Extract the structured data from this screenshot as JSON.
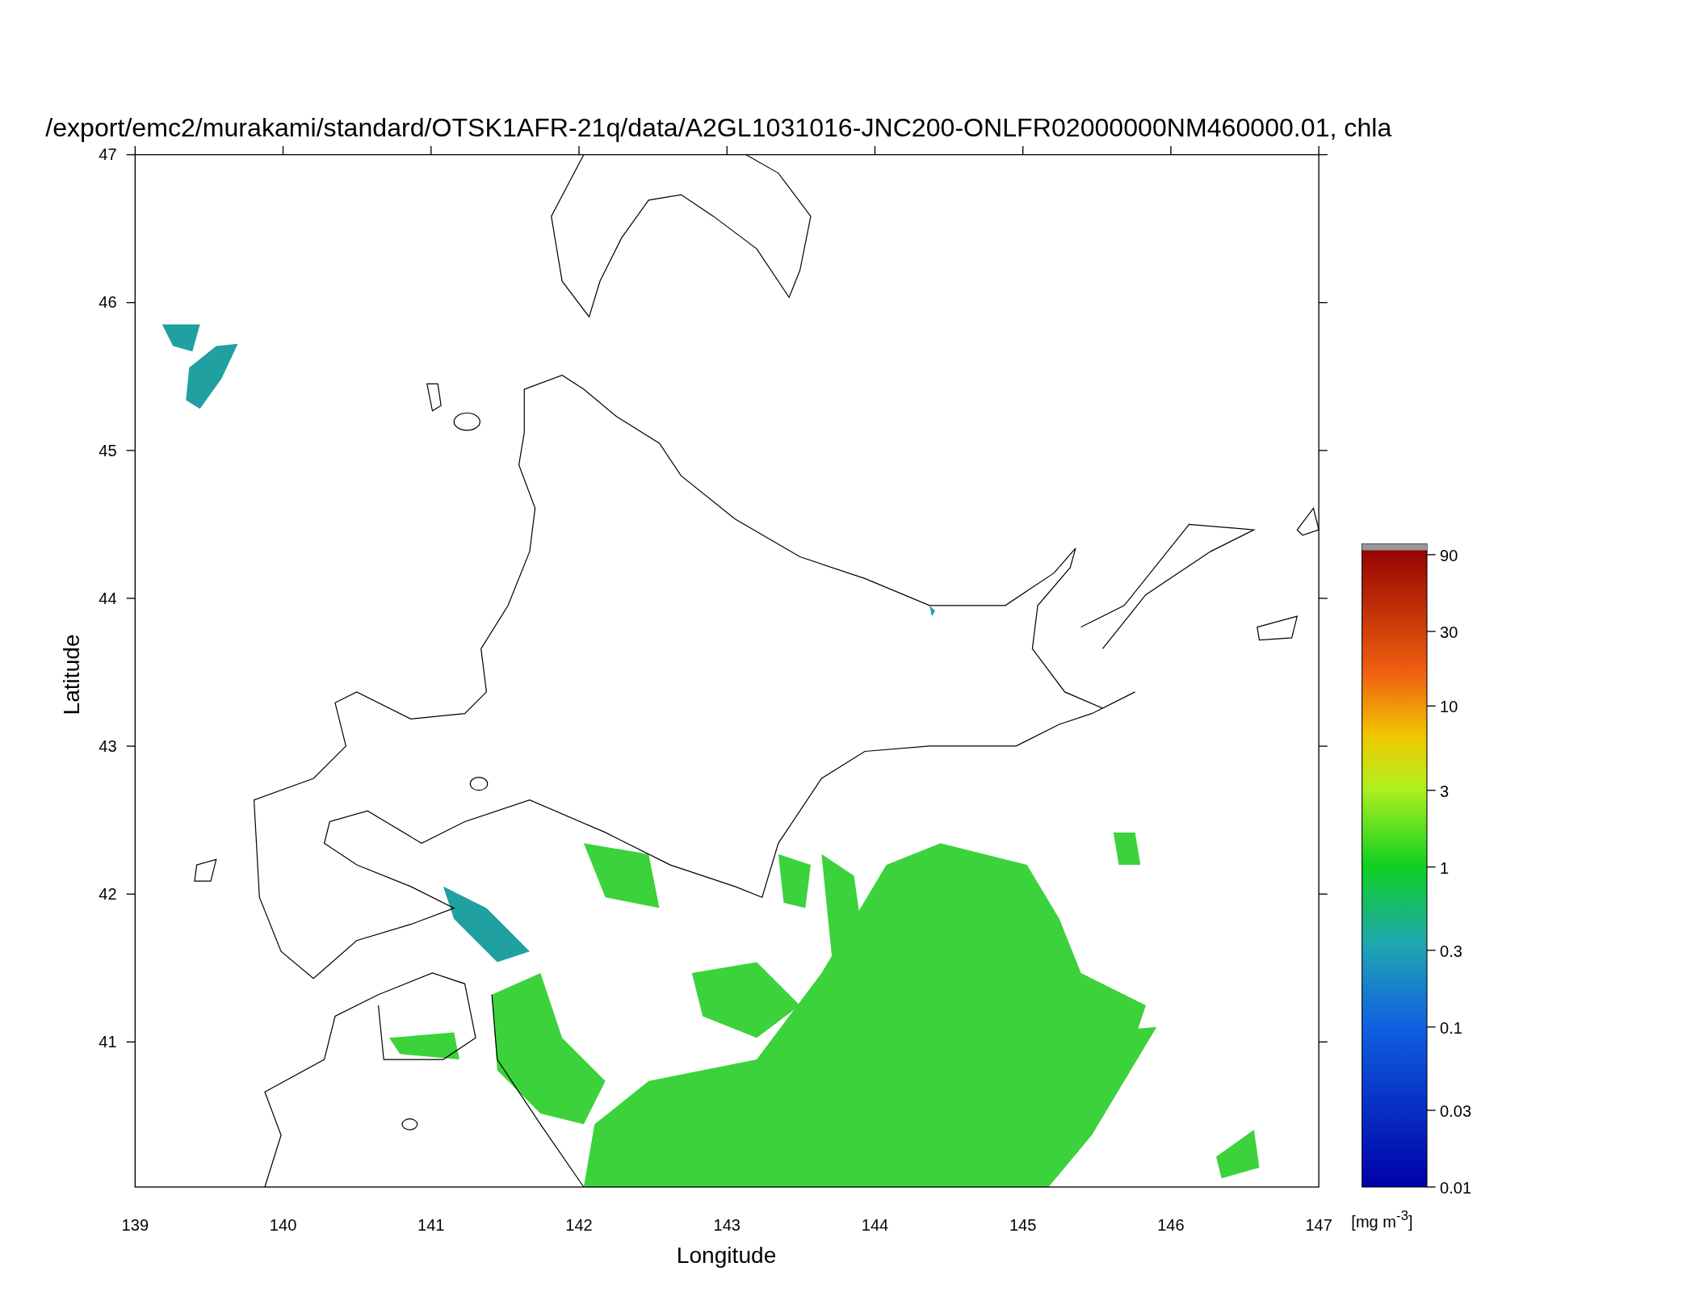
{
  "title": "/export/emc2/murakami/standard/OTSK1AFR-21q/data/A2GL1031016-JNC200-ONLFR02000000NM460000.01, chla",
  "x_axis": {
    "label": "Longitude",
    "ticks": [
      "139",
      "140",
      "141",
      "142",
      "143",
      "144",
      "145",
      "146",
      "147"
    ]
  },
  "y_axis": {
    "label": "Latitude",
    "ticks": [
      "47",
      "46",
      "45",
      "44",
      "43",
      "42",
      "41"
    ]
  },
  "colorbar": {
    "ticks": [
      "90",
      "30",
      "10",
      "3",
      "1",
      "0.3",
      "0.1",
      "0.03",
      "0.01"
    ],
    "unit": "[mg m$^{-3}$]"
  }
}
